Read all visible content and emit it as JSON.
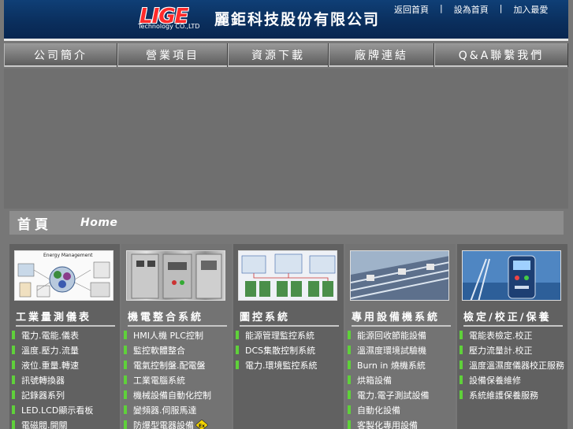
{
  "header": {
    "logo_text": "LIGE",
    "logo_sub": "Technology CO.,LTD",
    "company_name": "麗鉅科技股份有限公司",
    "links": [
      "返回首頁",
      "設為首頁",
      "加入最愛"
    ],
    "separator": "|"
  },
  "nav": {
    "items": [
      "公司簡介",
      "營業項目",
      "資源下載",
      "廠牌連結",
      "Q&A聯繫我們"
    ]
  },
  "page_title": {
    "zh": "首頁",
    "en": "Home"
  },
  "columns": [
    {
      "heading": "工業量測儀表",
      "image_label": "Energy Management",
      "items": [
        "電力.電能.儀表",
        "溫度.壓力.流量",
        "液位.重量.轉速",
        "訊號轉換器",
        "記錄器系列",
        "LED.LCD顯示看板",
        "電磁閥.開關"
      ]
    },
    {
      "heading": "機電整合系統",
      "items": [
        "HMI人機 PLC控制",
        "監控軟體整合",
        "電氣控制盤.配電盤",
        "工業電腦系統",
        "機械設備自動化控制",
        "變頻器.伺服馬達",
        "防爆型電器設備"
      ]
    },
    {
      "heading": "圖控系統",
      "items": [
        "能源管理監控系統",
        "DCS集散控制系統",
        "電力.環境監控系統"
      ]
    },
    {
      "heading": "專用設備機系統",
      "items": [
        "能源回收節能設備",
        "溫濕度環境試驗機",
        "Burn in 燒機系統",
        "烘箱設備",
        "電力.電子測試設備",
        "自動化設備",
        "客製化專用設備"
      ]
    },
    {
      "heading": "檢定/校正/保養",
      "items": [
        "電能表檢定.校正",
        "壓力流量計.校正",
        "溫度溫濕度儀器校正服務",
        "設備保養維修",
        "系統維護保養服務"
      ]
    }
  ],
  "colors": {
    "header_bg": "#0a2e5c",
    "bullet": "#5fd13a",
    "logo": "#ff2a2a"
  }
}
